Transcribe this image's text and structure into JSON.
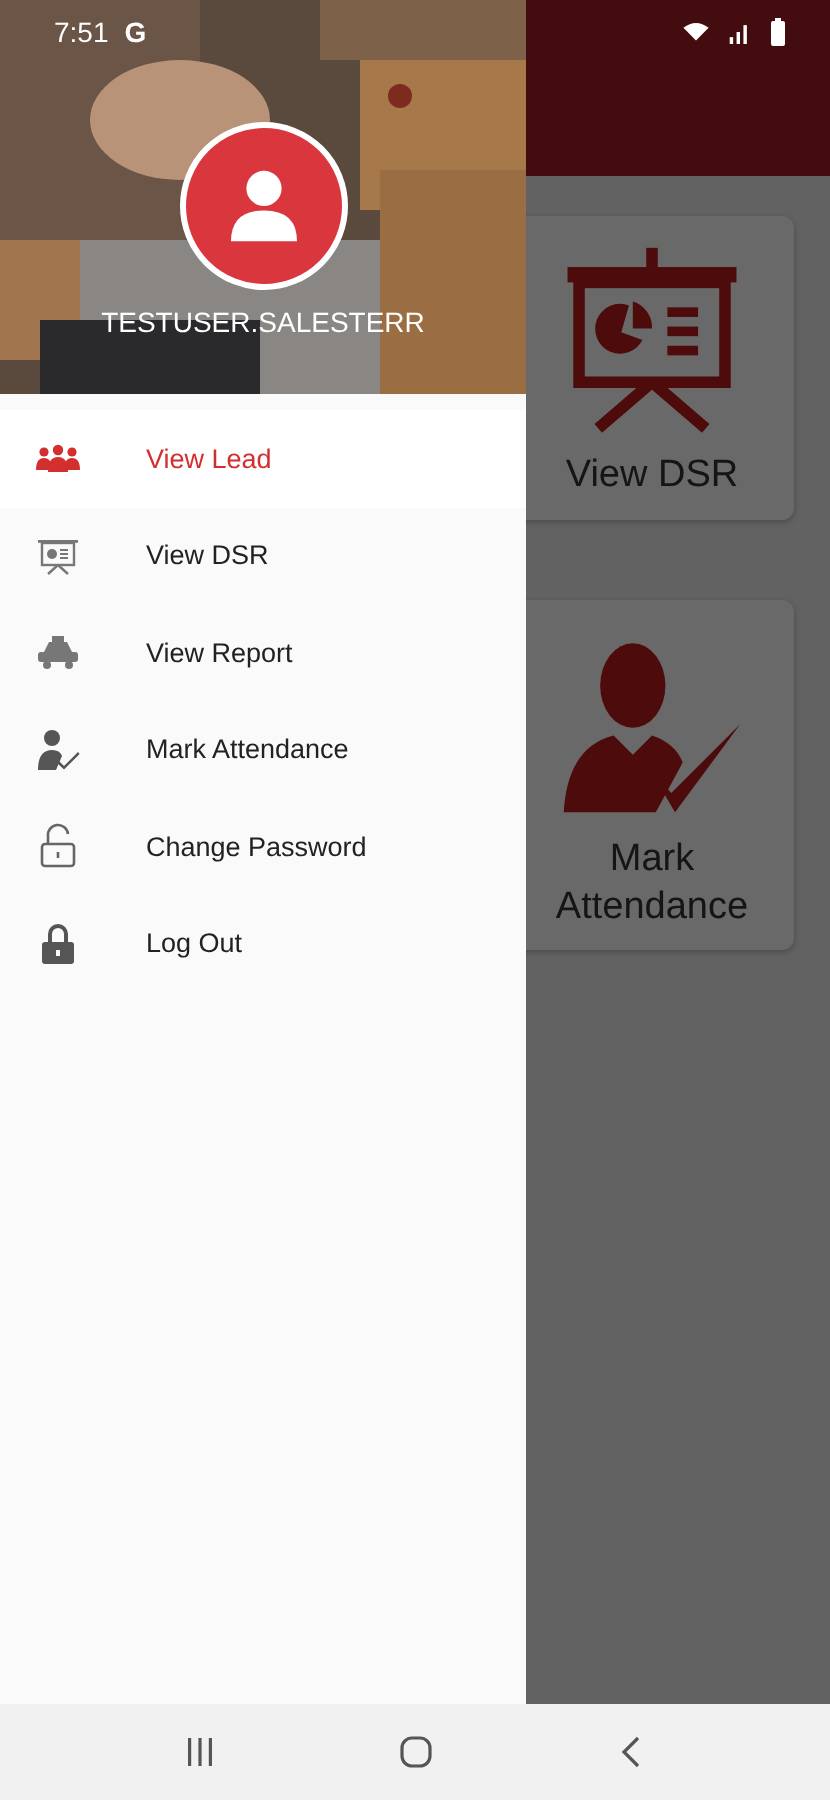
{
  "status_bar": {
    "time": "7:51",
    "notification": "G"
  },
  "drawer": {
    "username": "TESTUSER.SALESTERR",
    "items": [
      {
        "label": "View Lead",
        "kind": "lead",
        "selected": true
      },
      {
        "label": "View DSR",
        "kind": "dsr",
        "selected": false
      },
      {
        "label": "View Report",
        "kind": "report",
        "selected": false
      },
      {
        "label": "Mark Attendance",
        "kind": "attendance",
        "selected": false
      },
      {
        "label": "Change Password",
        "kind": "password",
        "selected": false
      },
      {
        "label": "Log Out",
        "kind": "logout",
        "selected": false
      }
    ]
  },
  "dashboard": {
    "cards": [
      {
        "label": "View DSR",
        "kind": "dsr"
      },
      {
        "label": "Mark Attendance",
        "kind": "attendance"
      }
    ]
  }
}
